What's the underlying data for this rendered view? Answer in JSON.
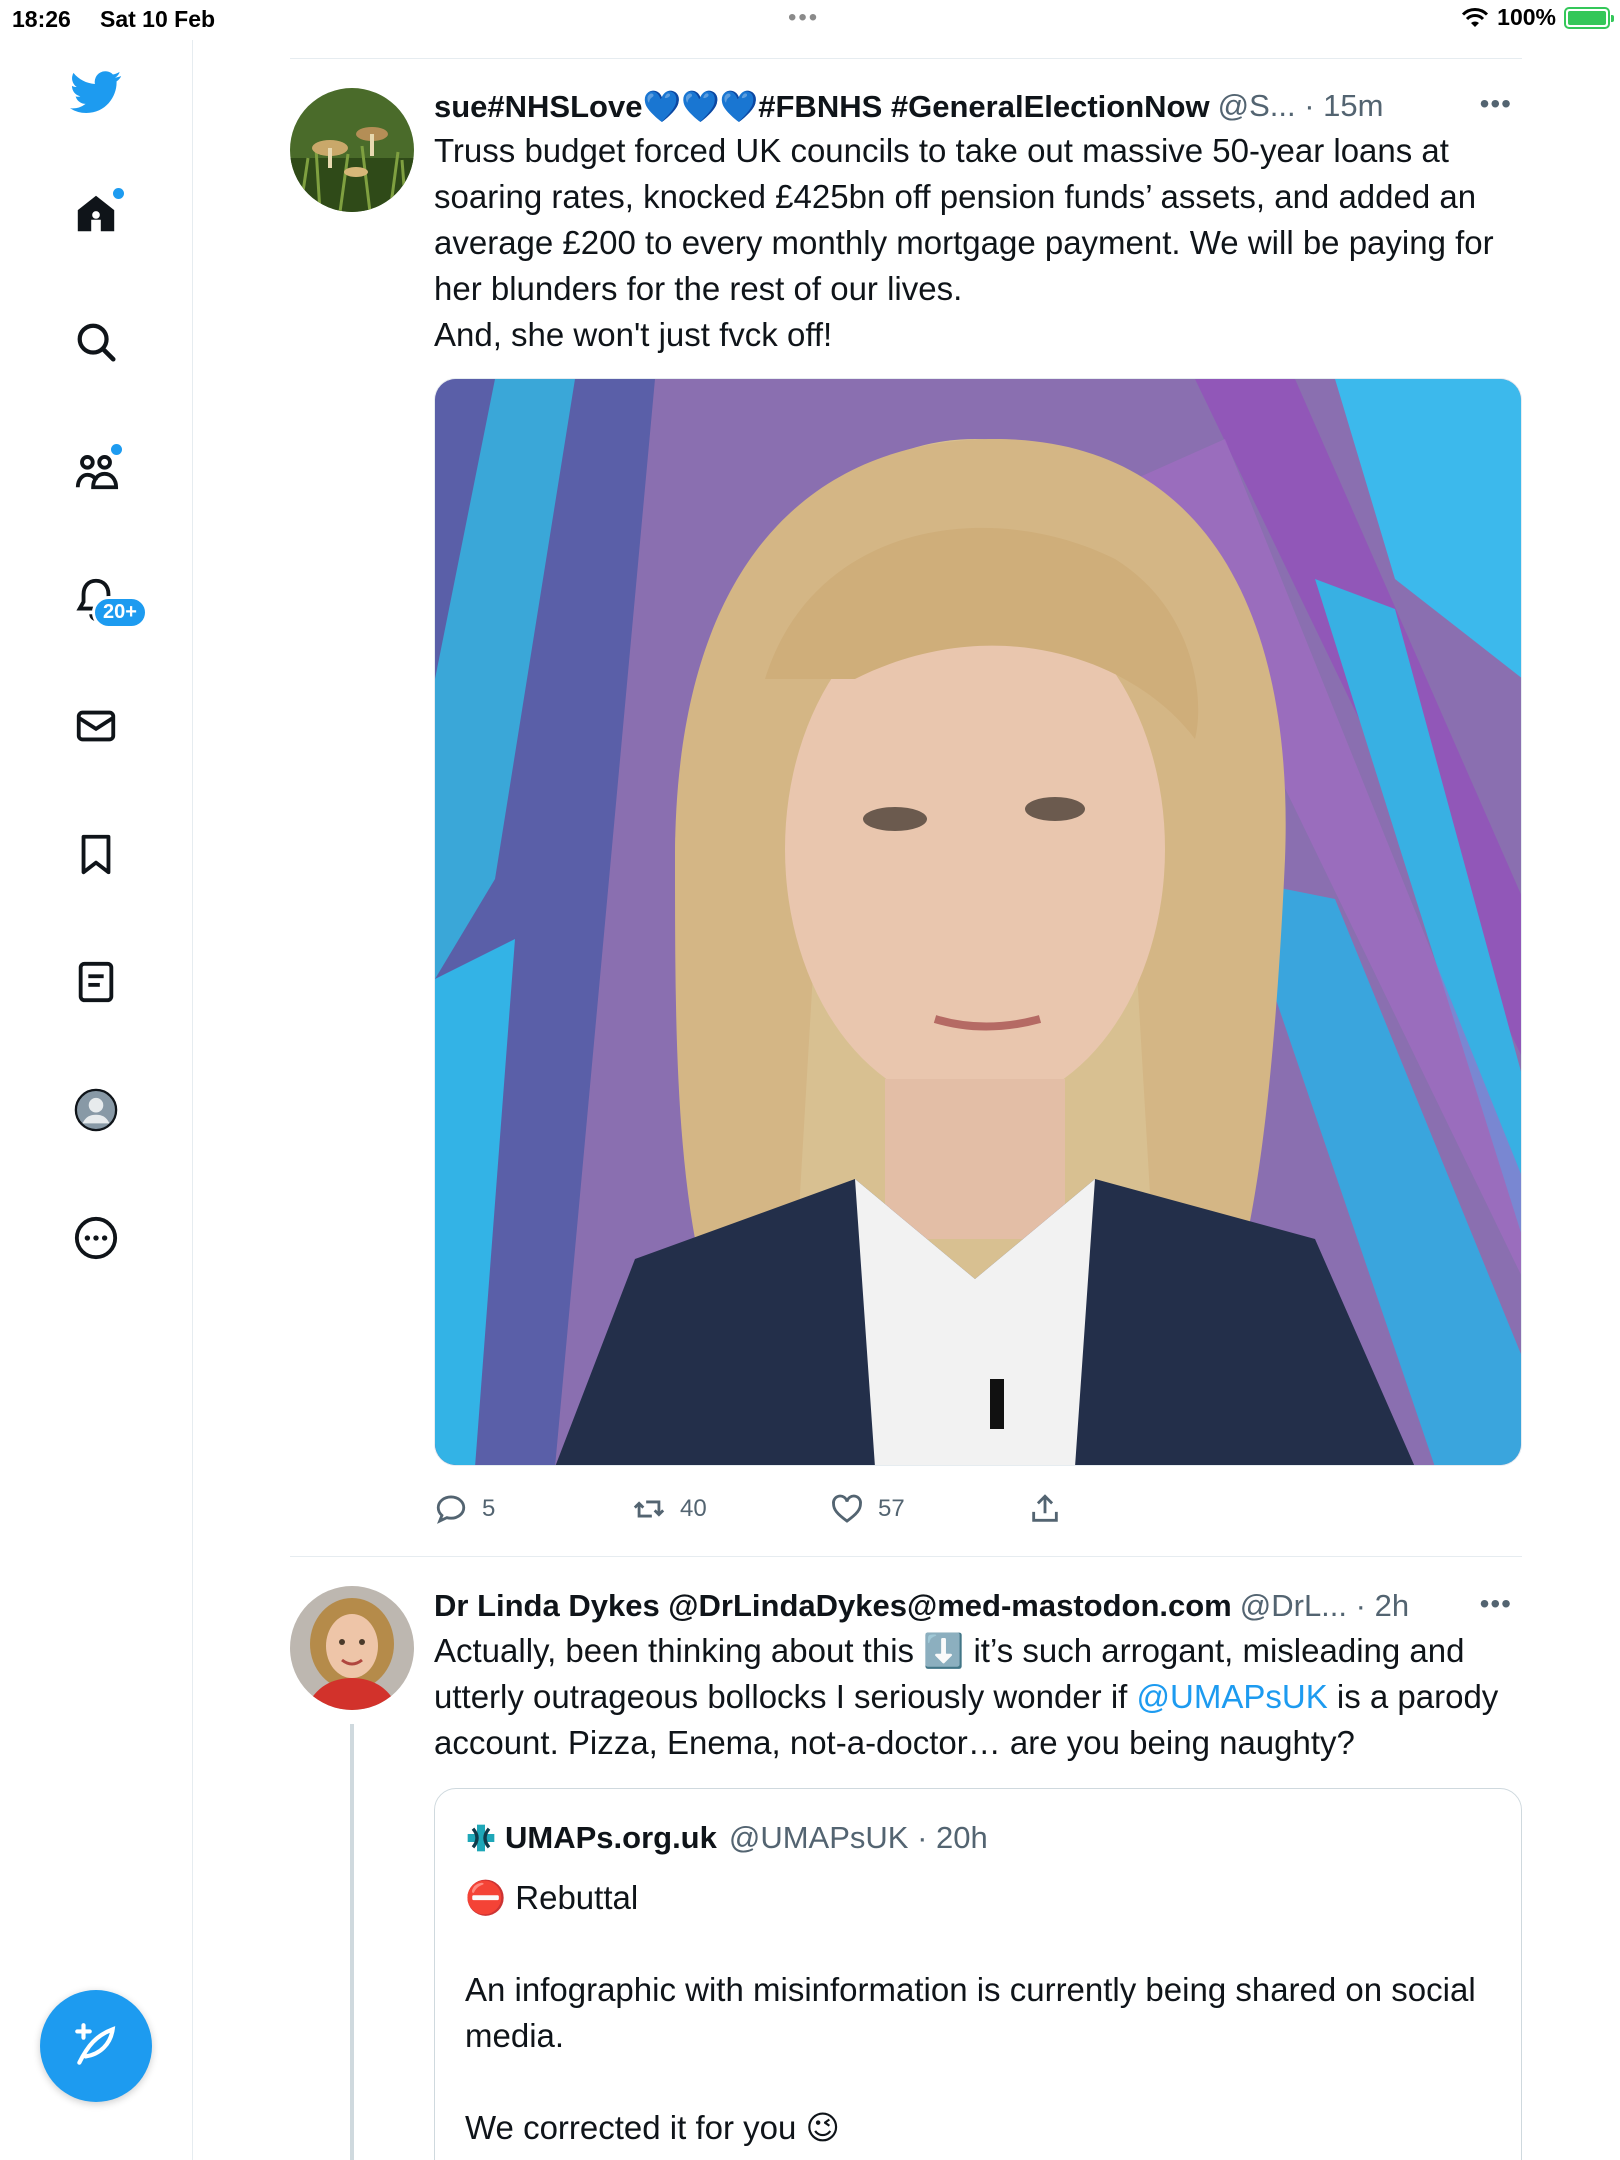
{
  "status_bar": {
    "time": "18:26",
    "date": "Sat 10 Feb",
    "battery": "100%",
    "battery_level": 1.0
  },
  "sidebar": {
    "items": [
      {
        "name": "twitter-logo",
        "icon": "bird-icon"
      },
      {
        "name": "home",
        "icon": "home-icon",
        "has_dot": true
      },
      {
        "name": "explore",
        "icon": "search-icon"
      },
      {
        "name": "communities",
        "icon": "people-icon",
        "has_dot": true
      },
      {
        "name": "notifications",
        "icon": "bell-icon",
        "badge": "20+"
      },
      {
        "name": "messages",
        "icon": "mail-icon"
      },
      {
        "name": "bookmarks",
        "icon": "bookmark-icon"
      },
      {
        "name": "lists",
        "icon": "list-icon"
      },
      {
        "name": "profile",
        "icon": "avatar-icon"
      },
      {
        "name": "more",
        "icon": "more-circle-icon"
      }
    ],
    "notifications_badge": "20+"
  },
  "tweets": [
    {
      "display_name": "sue#NHSLove💙💙💙#FBNHS #GeneralElectionNow",
      "handle": "@S... · 15m",
      "text": "Truss budget forced UK councils to take out massive 50-year loans at soaring rates, knocked £425bn off pension funds’ assets, and added an average £200 to every monthly mortgage payment. We will be paying for her blunders for the rest of our lives.\nAnd, she won't just fvck off!",
      "replies": "5",
      "retweets": "40",
      "likes": "57"
    },
    {
      "display_name": "Dr Linda Dykes @DrLindaDykes@med-mastodon.com",
      "handle": "@DrL... · 2h",
      "text_1": "Actually, been thinking about this ⬇️ it’s such arrogant, misleading and utterly outrageous bollocks I seriously wonder if ",
      "mention": "@UMAPsUK",
      "text_2": " is a parody account. Pizza, Enema, not-a-doctor… are you being naughty?",
      "quote": {
        "display_name": "UMAPs.org.uk",
        "handle": "@UMAPsUK · 20h",
        "text": "⛔ Rebuttal\n\nAn infographic with misinformation is currently being shared on social media.\n\nWe corrected it for you 😉"
      }
    }
  ],
  "colors": {
    "accent": "#1d9bf0",
    "text": "#0f1419",
    "secondary": "#536471",
    "battery": "#34c759"
  }
}
